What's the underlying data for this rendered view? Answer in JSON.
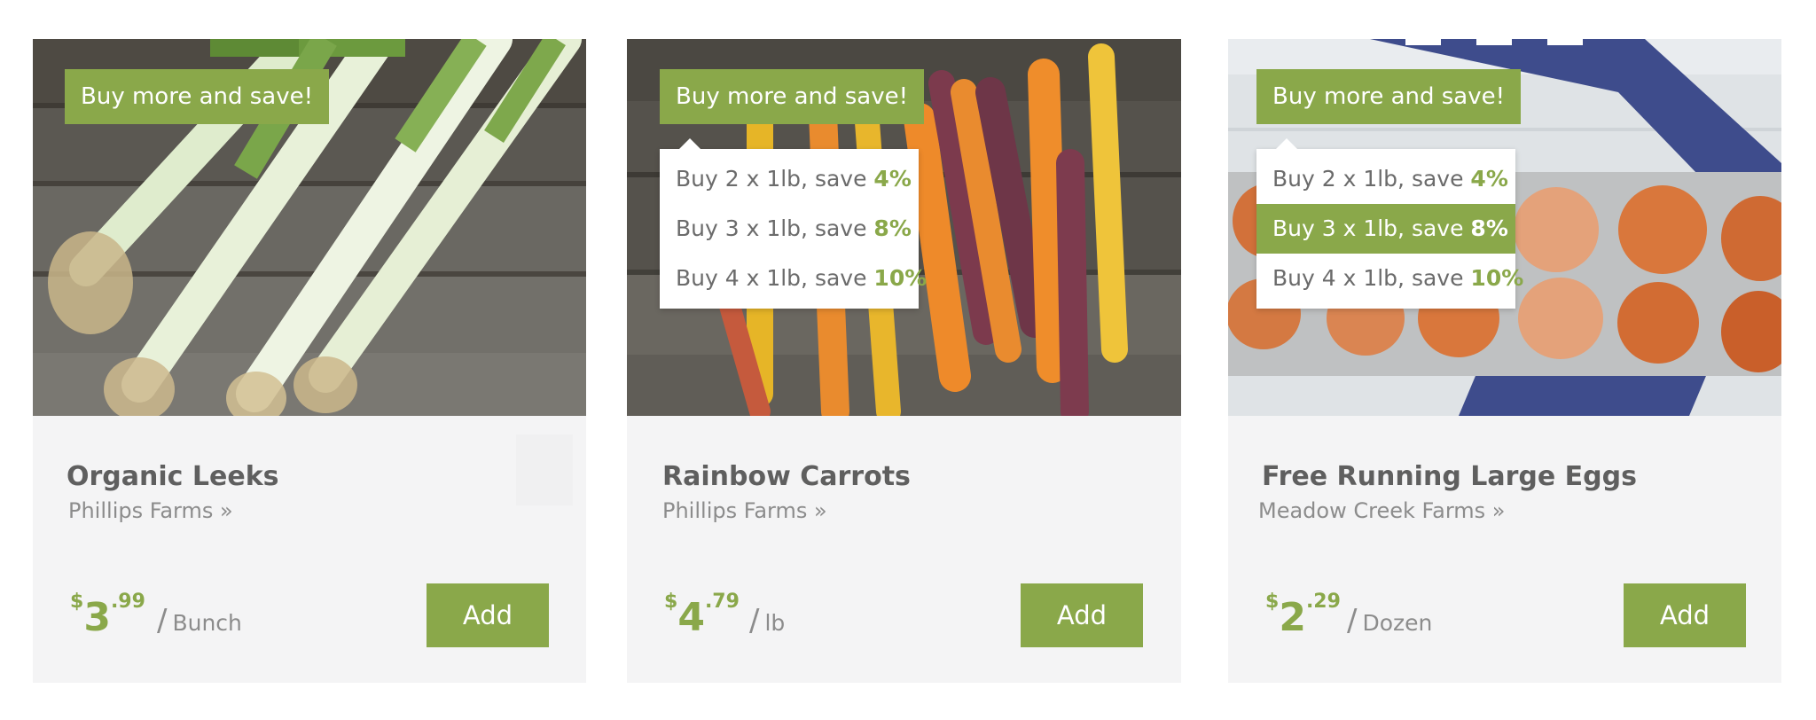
{
  "products": [
    {
      "promo": "Buy more and save!",
      "name": "Organic Leeks",
      "farm": "Phillips Farms »",
      "price": {
        "currency": "$",
        "dollars": "3",
        "cents": ".99",
        "separator": "/",
        "unit": "Bunch"
      },
      "add_label": "Add",
      "tiers": []
    },
    {
      "promo": "Buy more and save!",
      "name": "Rainbow Carrots",
      "farm": "Phillips Farms »",
      "price": {
        "currency": "$",
        "dollars": "4",
        "cents": ".79",
        "separator": "/",
        "unit": "lb"
      },
      "add_label": "Add",
      "tiers": [
        {
          "text": "Buy 2 x 1lb, save ",
          "pct": "4%"
        },
        {
          "text": "Buy 3 x 1lb, save ",
          "pct": "8%"
        },
        {
          "text": "Buy 4 x 1lb, save ",
          "pct": "10%"
        }
      ]
    },
    {
      "promo": "Buy more and save!",
      "name": "Free Running Large Eggs",
      "farm": "Meadow Creek Farms »",
      "price": {
        "currency": "$",
        "dollars": "2",
        "cents": ".29",
        "separator": "/",
        "unit": "Dozen"
      },
      "add_label": "Add",
      "selected_tier": 1,
      "tiers": [
        {
          "text": "Buy 2 x 1lb, save ",
          "pct": "4%"
        },
        {
          "text": "Buy 3 x 1lb, save ",
          "pct": "8%"
        },
        {
          "text": "Buy 4 x 1lb, save ",
          "pct": "10%"
        }
      ]
    }
  ],
  "colors": {
    "accent": "#8aa84a",
    "card_bg": "#f4f4f5",
    "text_dark": "#5f5f5f",
    "text_muted": "#8c8c8c"
  }
}
